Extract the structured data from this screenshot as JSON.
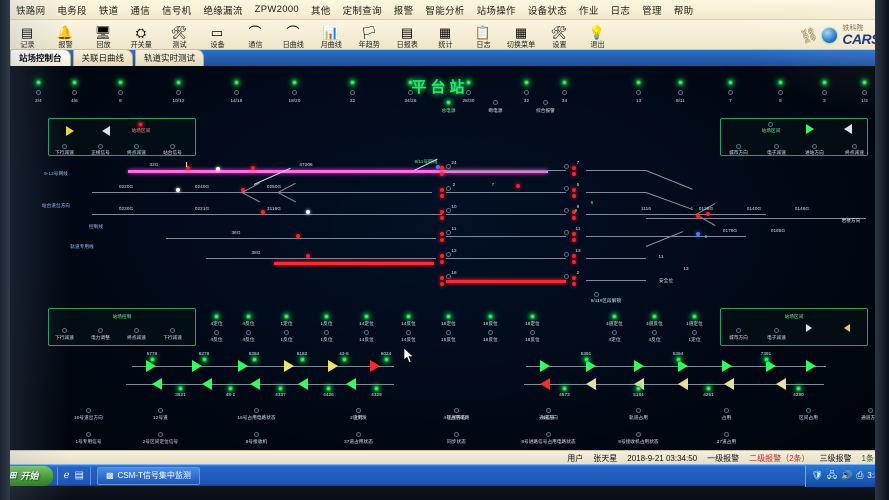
{
  "app": {
    "window_title": "CSM-T信号集中监测",
    "station_title": "平台站"
  },
  "menubar": {
    "items": [
      {
        "label": "铁路网"
      },
      {
        "label": "电务段"
      },
      {
        "label": "铁道"
      },
      {
        "label": "通信"
      },
      {
        "label": "信号机"
      },
      {
        "label": "绝缘漏流"
      },
      {
        "label": "ZPW2000"
      },
      {
        "label": "其他"
      },
      {
        "label": "定制查询"
      },
      {
        "label": "报警"
      },
      {
        "label": "智能分析"
      },
      {
        "label": "站场操作"
      },
      {
        "label": "设备状态"
      },
      {
        "label": "作业"
      },
      {
        "label": "日志"
      },
      {
        "label": "管理"
      },
      {
        "label": "帮助"
      }
    ]
  },
  "toolbar": {
    "buttons": [
      {
        "label": "记录",
        "icon": "record-icon",
        "glyph": "▤"
      },
      {
        "label": "报警",
        "icon": "bell-icon",
        "glyph": "🔔"
      },
      {
        "label": "回放",
        "icon": "monitor-icon",
        "glyph": "🖥"
      },
      {
        "label": "开关量",
        "icon": "switch-icon",
        "glyph": "⛭"
      },
      {
        "label": "测试",
        "icon": "wrench-icon",
        "glyph": "🛠"
      },
      {
        "label": "设备",
        "icon": "device-icon",
        "glyph": "▭"
      },
      {
        "label": "通信",
        "icon": "link-icon",
        "glyph": "⌒"
      },
      {
        "label": "日曲线",
        "icon": "day-curve-icon",
        "glyph": "⌒"
      },
      {
        "label": "月曲线",
        "icon": "month-curve-icon",
        "glyph": "📊"
      },
      {
        "label": "年趋势",
        "icon": "year-trend-icon",
        "glyph": "🏳"
      },
      {
        "label": "日报表",
        "icon": "day-report-icon",
        "glyph": "▤"
      },
      {
        "label": "统计",
        "icon": "statistics-icon",
        "glyph": "▦"
      },
      {
        "label": "日志",
        "icon": "clipboard-icon",
        "glyph": "📋"
      },
      {
        "label": "切换菜单",
        "icon": "calendar-icon",
        "glyph": "▦"
      },
      {
        "label": "设置",
        "icon": "tools-icon",
        "glyph": "🛠"
      },
      {
        "label": "退出",
        "icon": "bulb-icon",
        "glyph": "💡"
      }
    ],
    "logo_cn": "铁科院",
    "logo_en": "CARS"
  },
  "tabs": [
    {
      "label": "站场控制台",
      "active": true
    },
    {
      "label": "关联日曲线",
      "active": false
    },
    {
      "label": "轨道实时测试",
      "active": false
    }
  ],
  "diagram": {
    "top_indicators": [
      {
        "label": "2/4",
        "on": true
      },
      {
        "label": "4/6",
        "on": true
      },
      {
        "label": "8",
        "on": true
      },
      {
        "label": "10/12",
        "on": true
      },
      {
        "label": "14/16",
        "on": true
      },
      {
        "label": "18/20",
        "on": true
      },
      {
        "label": "22",
        "on": true
      },
      {
        "label": "24/26",
        "on": true
      },
      {
        "label": "28/30",
        "on": true
      },
      {
        "label": "32",
        "on": true
      },
      {
        "label": "34",
        "on": true
      }
    ],
    "top_right_indicators": [
      {
        "label": "13",
        "on": true
      },
      {
        "label": "9/11",
        "on": true
      },
      {
        "label": "7",
        "on": true
      },
      {
        "label": "5",
        "on": true
      },
      {
        "label": "3",
        "on": true
      },
      {
        "label": "1/3",
        "on": true
      }
    ],
    "top_center_lamps": [
      {
        "label": "总电源",
        "on": true
      },
      {
        "label": "断电源",
        "on": false
      },
      {
        "label": "综合报警",
        "on": false
      }
    ],
    "left_box": {
      "title": "站场控制",
      "center_label": "站场区间",
      "arrow_right": "出站方向",
      "arrow_left": "进站方向",
      "sub_labels": [
        "下行减速",
        "正线信号",
        "终点减速",
        "站台信号"
      ]
    },
    "left_box2": {
      "title": "站场控制",
      "sub_labels": [
        "下行减速",
        "电力调整",
        "终点减速",
        "下行减速"
      ]
    },
    "right_box": {
      "title": "站场区间",
      "sub_labels": [
        "城市方向",
        "电子减速",
        "进站方向",
        "终点减速"
      ]
    },
    "right_box2": {
      "title": "站场区间",
      "sub_labels": [
        "城市方向",
        "电子减速",
        "进站方向",
        "终点减速"
      ]
    },
    "track_labels_left": [
      "9-13号网线",
      "站台道岔方向",
      "控制线",
      "轨道专用线"
    ],
    "track_circuits_row1": [
      "32G",
      "47206"
    ],
    "track_circuits_row2": [
      "0220G",
      "0240G",
      "0250G"
    ],
    "track_circuits_row3": [
      "0230G",
      "0221G",
      "3116G"
    ],
    "track_circuits_row4": [
      "36G"
    ],
    "track_circuits_row5": [
      "38G"
    ],
    "right_track_circuits": [
      "1116",
      "0128G",
      "0140G",
      "0146G",
      "0179G",
      "0185G"
    ],
    "right_labels": [
      "岩楼方向",
      "安全位",
      "9/11#区段解锁"
    ],
    "track_numbers": [
      "24",
      "2",
      "10",
      "11",
      "12",
      "16",
      "18"
    ],
    "switch_numbers": [
      "7",
      "5",
      "9",
      "11",
      "13",
      "2",
      "1"
    ],
    "mid_indicators_top": [
      "4定位",
      "4反位",
      "1定位",
      "1反位",
      "14定位",
      "14反位",
      "16定位",
      "16反位",
      "18定位"
    ],
    "mid_indicators_bottom": [
      "4定位",
      "4反位",
      "1定位",
      "1反位",
      "14定位",
      "14反位",
      "16定位",
      "16反位",
      "18定位"
    ],
    "mid_indicators_top2": [
      "4道定位",
      "4道反位",
      "1道定位",
      "1道反位",
      "14道定位",
      "14道反位",
      "16道定位",
      "16道反位",
      "18道定位"
    ],
    "bottom_left_labels": [
      "10号道岔方向",
      "12号道",
      "16号占用电路状态",
      "2道到发",
      "4号占用电路",
      "通道方向"
    ],
    "bottom_right_labels": [
      "上行",
      "区间方向",
      "4号道",
      "轨道占用",
      "占用",
      "区间占用",
      "通道方向"
    ],
    "bottom_row2_labels": [
      "1号专用信号",
      "2号区间定位信号",
      "8号接收机",
      "37道占用状态",
      "同步状态",
      "8号进路信号占用电路状态",
      "8号接收机占用状态",
      "37道占用"
    ],
    "approach_left_top_codes": [
      "5778",
      "6278",
      "4384",
      "6182",
      "42-6",
      "6024"
    ],
    "approach_left_bot_codes": [
      "3621",
      "48-1",
      "4337",
      "4426",
      "4329"
    ],
    "approach_right_top_codes": [
      "5391",
      "5394",
      "7391"
    ],
    "approach_right_bot_codes": [
      "4573",
      "5184",
      "4261",
      "4290"
    ]
  },
  "statusbar": {
    "user_label": "用户",
    "user_name": "张天星",
    "datetime": "2018-9-21 03:34:50",
    "alarm1": "一级报警",
    "alarm2": "二级报警（2条）",
    "alarm3": "三级报警",
    "alarm3_count": "1条"
  },
  "taskbar": {
    "start_label": "开始",
    "quick_icons": [
      "ie-icon",
      "desktop-icon"
    ],
    "window_label": "CSM-T信号集中监测",
    "tray_icons": [
      "shield-icon",
      "network-icon",
      "volume-icon",
      "usb-icon",
      "display-icon"
    ],
    "clock": "3:34"
  }
}
